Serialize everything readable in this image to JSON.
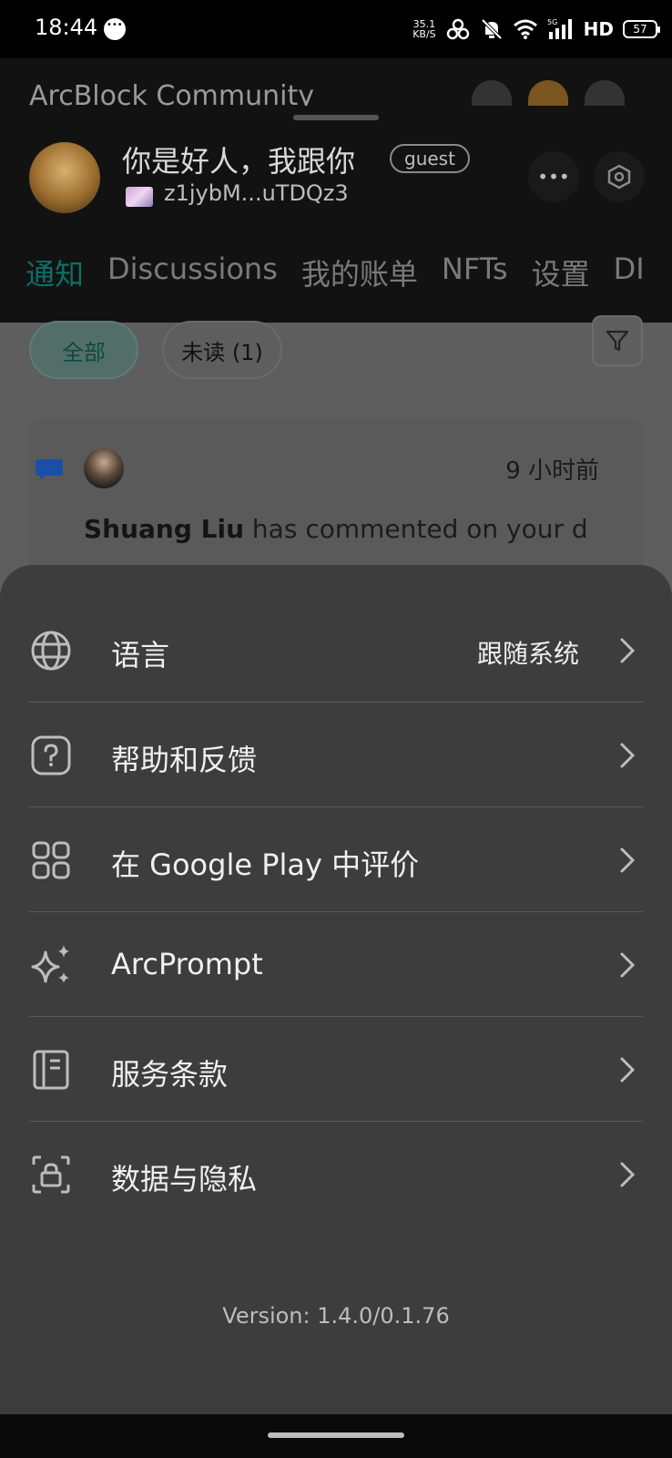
{
  "status_bar": {
    "time": "18:44",
    "net_speed_value": "35.1",
    "net_speed_unit": "KB/S",
    "network_label": "HD",
    "signal_label": "5G",
    "battery": "57"
  },
  "header": {
    "community_title": "ArcBlock Community",
    "profile_name": "你是好人，我跟你",
    "role_badge": "guest",
    "did_address": "z1jybM...uTDQz3"
  },
  "tabs": [
    {
      "label": "通知",
      "active": true
    },
    {
      "label": "Discussions",
      "active": false
    },
    {
      "label": "我的账单",
      "active": false
    },
    {
      "label": "NFTs",
      "active": false
    },
    {
      "label": "设置",
      "active": false
    },
    {
      "label": "DI",
      "active": false
    }
  ],
  "filters": {
    "all_label": "全部",
    "unread_label": "未读 (1)"
  },
  "notification": {
    "time": "9 小时前",
    "actor": "Shuang Liu",
    "message": " has commented on your d"
  },
  "menu": {
    "items": [
      {
        "label": "语言",
        "value": "跟随系统",
        "icon": "globe-icon"
      },
      {
        "label": "帮助和反馈",
        "value": "",
        "icon": "help-icon"
      },
      {
        "label": "在 Google Play 中评价",
        "value": "",
        "icon": "grid-icon"
      },
      {
        "label": "ArcPrompt",
        "value": "",
        "icon": "sparkle-icon"
      },
      {
        "label": "服务条款",
        "value": "",
        "icon": "book-icon"
      },
      {
        "label": "数据与隐私",
        "value": "",
        "icon": "privacy-lock-icon"
      }
    ],
    "version": "Version: 1.4.0/0.1.76"
  },
  "colors": {
    "accent": "#0d6f64",
    "sheet_bg": "#3d3d3d",
    "overlay": "#5e5e5e"
  }
}
